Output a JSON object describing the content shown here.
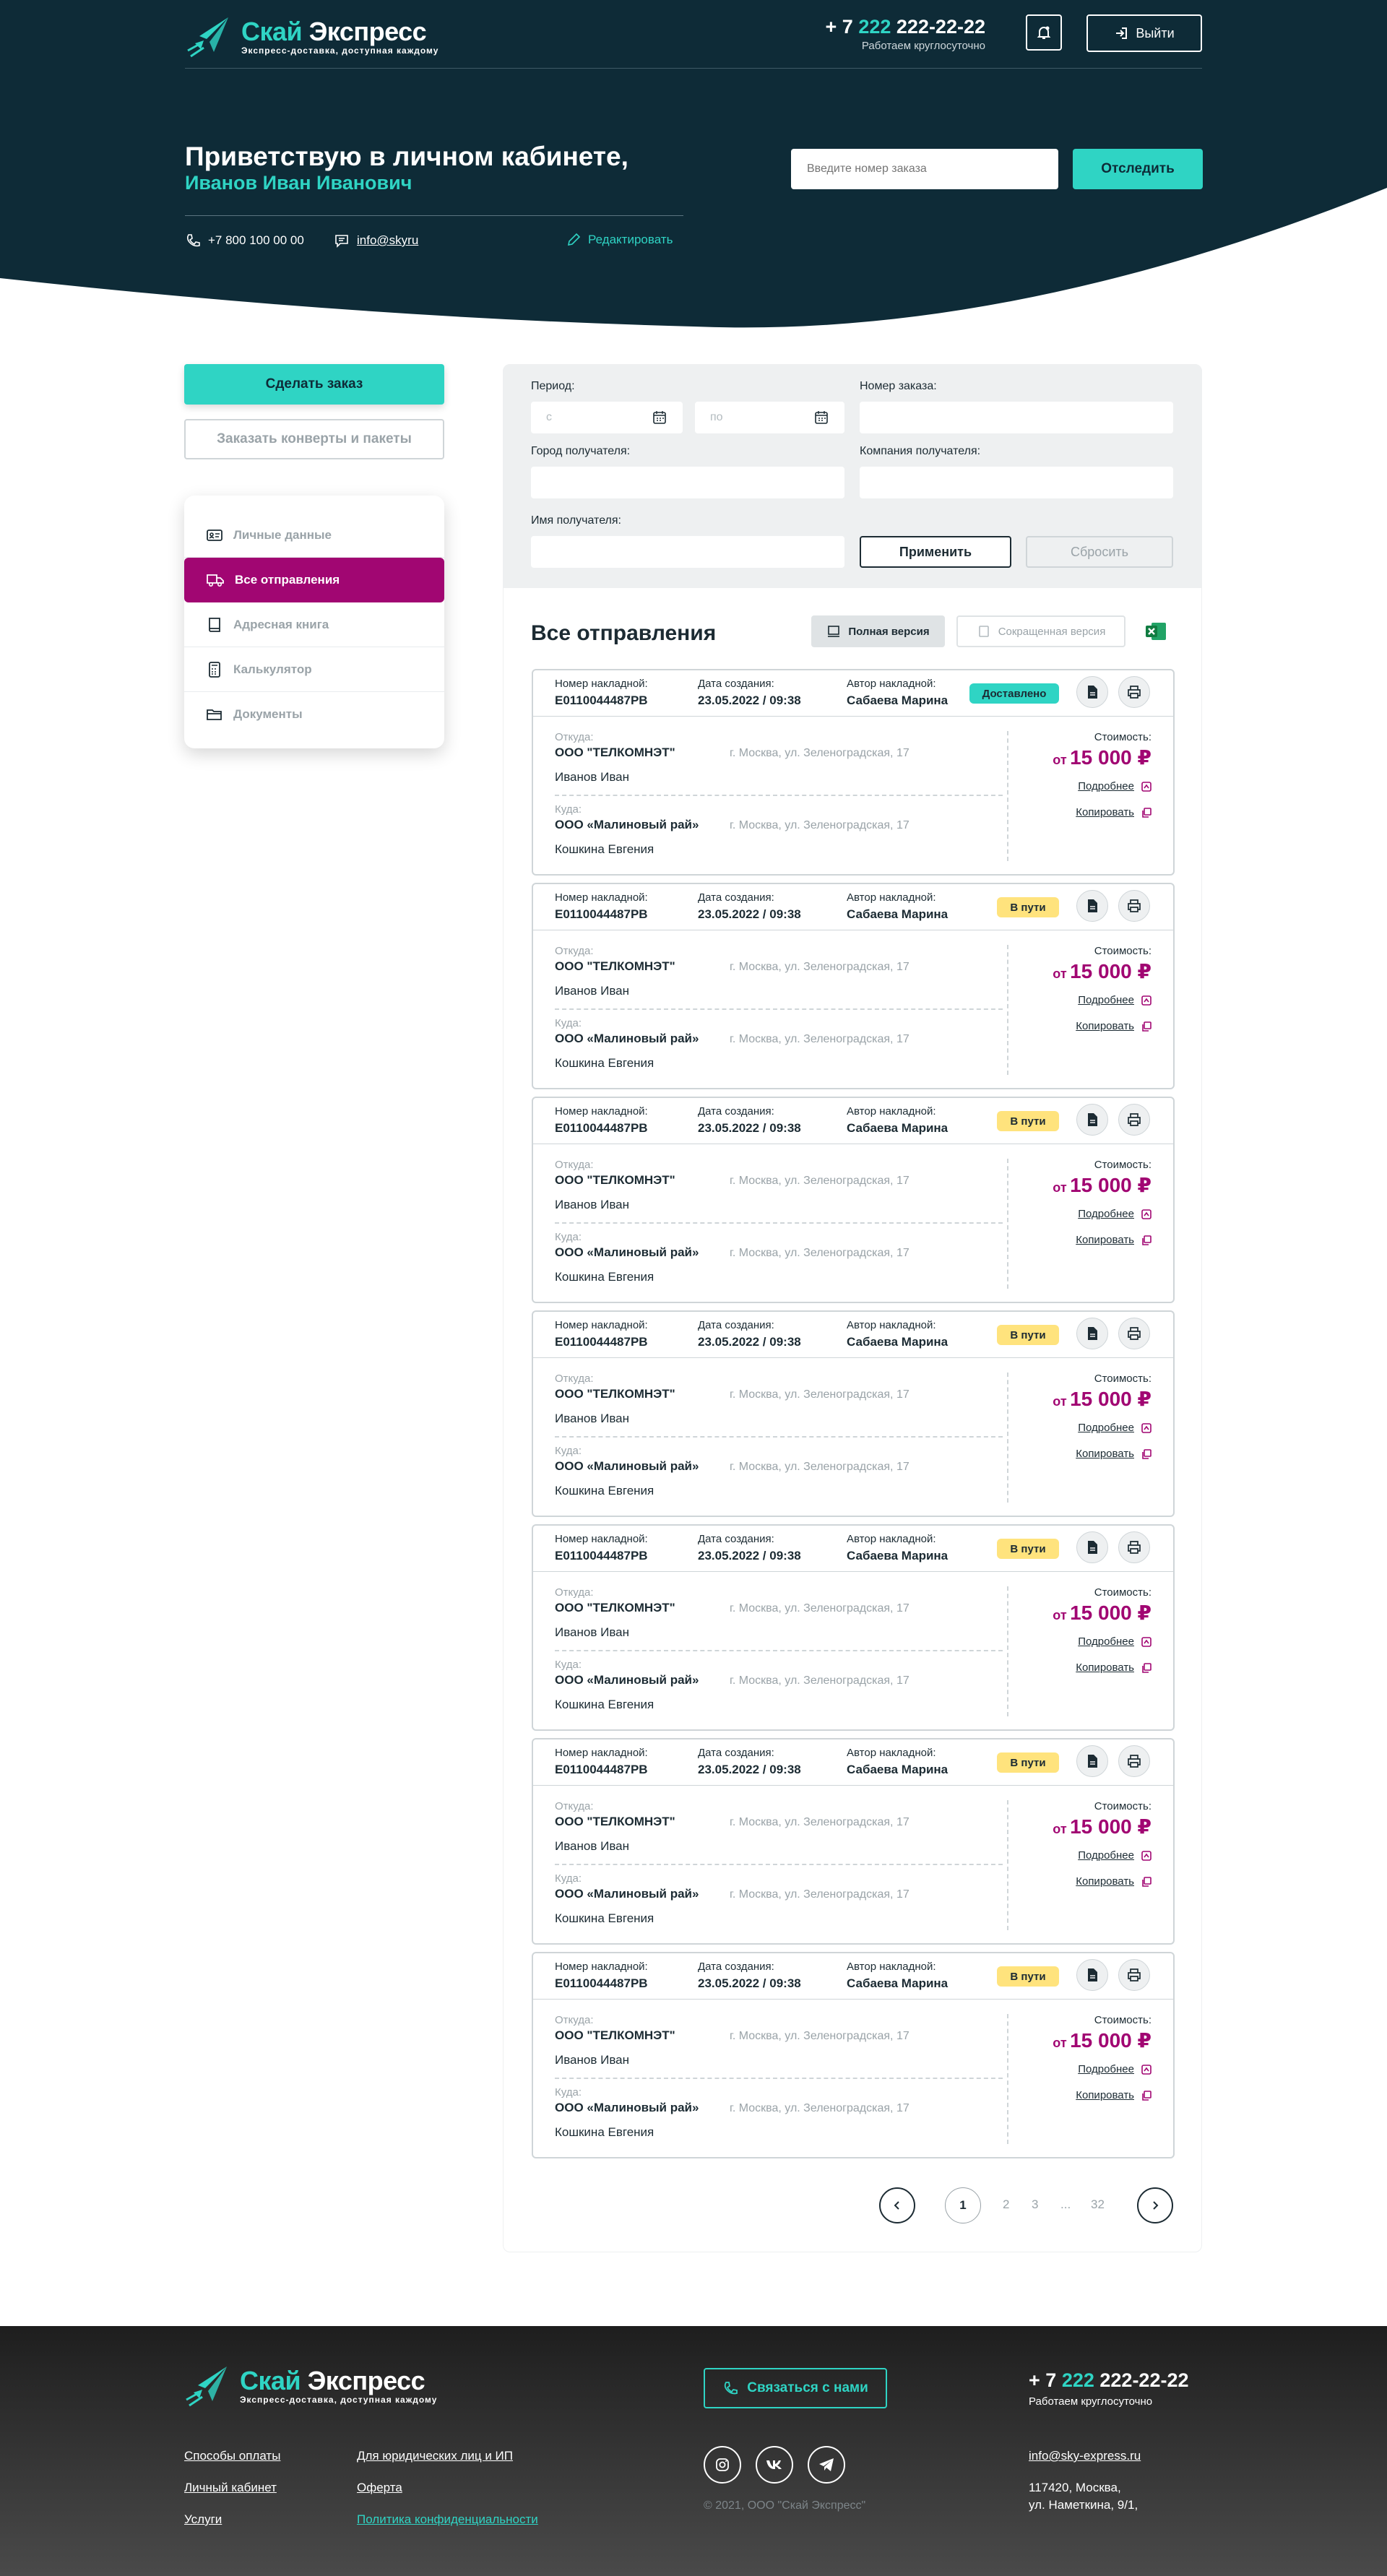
{
  "header": {
    "brand": "Скай Экспресс",
    "tagline": "Экспресс-доставка, доступная каждому",
    "phone_prefix": "+ 7",
    "phone_code": "222",
    "phone_rest": "222-22-22",
    "hours": "Работаем круглосуточно",
    "logout_label": "Выйти"
  },
  "hero": {
    "greeting": "Приветствую в личном кабинете,",
    "user_name": "Иванов Иван Иванович",
    "phone": "+7 800 100 00 00",
    "email": "info@skyru",
    "edit_label": "Редактировать",
    "track_placeholder": "Введите номер заказа",
    "track_button": "Отследить"
  },
  "sidebar": {
    "order_button": "Сделать заказ",
    "envelopes_button": "Заказать конверты и пакеты",
    "items": [
      {
        "label": "Личные данные",
        "icon": "id-card-icon",
        "active": false
      },
      {
        "label": "Все отправления",
        "icon": "truck-icon",
        "active": true
      },
      {
        "label": "Адресная книга",
        "icon": "book-icon",
        "active": false
      },
      {
        "label": "Калькулятор",
        "icon": "calculator-icon",
        "active": false
      },
      {
        "label": "Документы",
        "icon": "folder-icon",
        "active": false
      }
    ]
  },
  "filters": {
    "period_label": "Период:",
    "from_placeholder": "с",
    "to_placeholder": "по",
    "order_number_label": "Номер заказа:",
    "city_label": "Город получателя:",
    "company_label": "Компания получателя:",
    "name_label": "Имя получателя:",
    "apply_button": "Применить",
    "reset_button": "Сбросить"
  },
  "list": {
    "title": "Все отправления",
    "full_version": "Полная версия",
    "short_version": "Сокращенная версия",
    "labels": {
      "invoice": "Номер накладной:",
      "created": "Дата создания:",
      "author": "Автор накладной:",
      "from": "Откуда:",
      "to": "Куда:",
      "cost": "Стоимость:",
      "cost_prefix": "от",
      "more": "Подробнее",
      "copy": "Копировать"
    },
    "shipments": [
      {
        "invoice": "E0110044487PB",
        "created": "23.05.2022 / 09:38",
        "author": "Сабаева Марина",
        "status": "Доставлено",
        "from_company": "ООО \"ТЕЛКОМНЭТ\"",
        "from_address": "г. Москва, ул. Зеленоградская, 17",
        "from_person": "Иванов Иван",
        "to_company": "ООО «Малиновый рай»",
        "to_address": "г. Москва, ул. Зеленоградская, 17",
        "to_person": "Кошкина Евгения",
        "cost": "15 000 ₽"
      },
      {
        "invoice": "E0110044487PB",
        "created": "23.05.2022 / 09:38",
        "author": "Сабаева Марина",
        "status": "В пути",
        "from_company": "ООО \"ТЕЛКОМНЭТ\"",
        "from_address": "г. Москва, ул. Зеленоградская, 17",
        "from_person": "Иванов Иван",
        "to_company": "ООО «Малиновый рай»",
        "to_address": "г. Москва, ул. Зеленоградская, 17",
        "to_person": "Кошкина Евгения",
        "cost": "15 000 ₽"
      },
      {
        "invoice": "E0110044487PB",
        "created": "23.05.2022 / 09:38",
        "author": "Сабаева Марина",
        "status": "В пути",
        "from_company": "ООО \"ТЕЛКОМНЭТ\"",
        "from_address": "г. Москва, ул. Зеленоградская, 17",
        "from_person": "Иванов Иван",
        "to_company": "ООО «Малиновый рай»",
        "to_address": "г. Москва, ул. Зеленоградская, 17",
        "to_person": "Кошкина Евгения",
        "cost": "15 000 ₽"
      },
      {
        "invoice": "E0110044487PB",
        "created": "23.05.2022 / 09:38",
        "author": "Сабаева Марина",
        "status": "В пути",
        "from_company": "ООО \"ТЕЛКОМНЭТ\"",
        "from_address": "г. Москва, ул. Зеленоградская, 17",
        "from_person": "Иванов Иван",
        "to_company": "ООО «Малиновый рай»",
        "to_address": "г. Москва, ул. Зеленоградская, 17",
        "to_person": "Кошкина Евгения",
        "cost": "15 000 ₽"
      },
      {
        "invoice": "E0110044487PB",
        "created": "23.05.2022 / 09:38",
        "author": "Сабаева Марина",
        "status": "В пути",
        "from_company": "ООО \"ТЕЛКОМНЭТ\"",
        "from_address": "г. Москва, ул. Зеленоградская, 17",
        "from_person": "Иванов Иван",
        "to_company": "ООО «Малиновый рай»",
        "to_address": "г. Москва, ул. Зеленоградская, 17",
        "to_person": "Кошкина Евгения",
        "cost": "15 000 ₽"
      },
      {
        "invoice": "E0110044487PB",
        "created": "23.05.2022 / 09:38",
        "author": "Сабаева Марина",
        "status": "В пути",
        "from_company": "ООО \"ТЕЛКОМНЭТ\"",
        "from_address": "г. Москва, ул. Зеленоградская, 17",
        "from_person": "Иванов Иван",
        "to_company": "ООО «Малиновый рай»",
        "to_address": "г. Москва, ул. Зеленоградская, 17",
        "to_person": "Кошкина Евгения",
        "cost": "15 000 ₽"
      },
      {
        "invoice": "E0110044487PB",
        "created": "23.05.2022 / 09:38",
        "author": "Сабаева Марина",
        "status": "В пути",
        "from_company": "ООО \"ТЕЛКОМНЭТ\"",
        "from_address": "г. Москва, ул. Зеленоградская, 17",
        "from_person": "Иванов Иван",
        "to_company": "ООО «Малиновый рай»",
        "to_address": "г. Москва, ул. Зеленоградская, 17",
        "to_person": "Кошкина Евгения",
        "cost": "15 000 ₽"
      }
    ]
  },
  "pagination": {
    "current": "1",
    "pages": [
      "2",
      "3"
    ],
    "ellipsis": "...",
    "last": "32"
  },
  "footer": {
    "brand": "Скай Экспресс",
    "tagline": "Экспресс-доставка, доступная каждому",
    "contact_button": "Связаться с нами",
    "phone_prefix": "+ 7",
    "phone_code": "222",
    "phone_rest": "222-22-22",
    "hours": "Работаем круглосуточно",
    "links_col1": [
      "Способы оплаты",
      "Личный кабинет",
      "Услуги"
    ],
    "links_col2": [
      "Для юридических лиц и ИП",
      "Оферта",
      "Политика конфиденциальности"
    ],
    "copyright": "© 2021, ООО \"Скай Экспресс\"",
    "email": "info@sky-express.ru",
    "address_line1": "117420, Москва,",
    "address_line2": "ул. Наметкина, 9/1,"
  },
  "colors": {
    "dark": "#0e2b37",
    "teal": "#2fd4c4",
    "magenta": "#a10672",
    "delivered": "#2fd4c4",
    "in_transit": "#ffe37d"
  }
}
